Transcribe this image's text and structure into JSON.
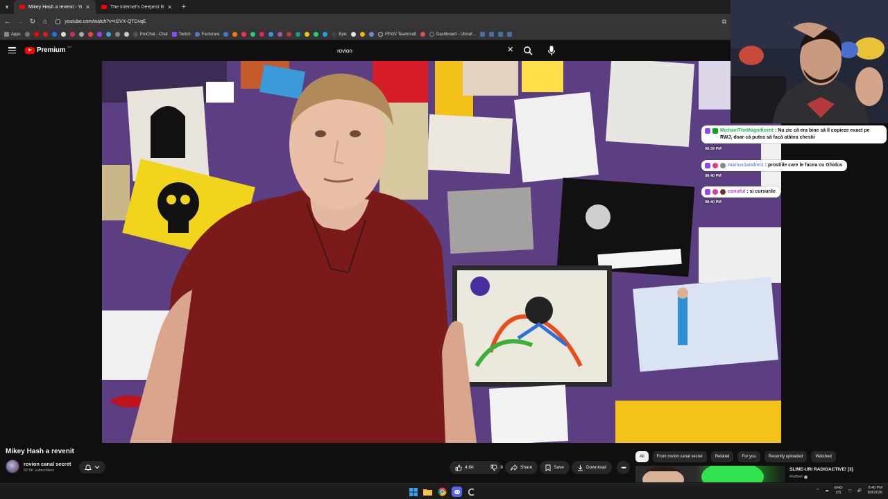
{
  "browser": {
    "tabs": [
      {
        "title": "Mikey Hash a revenit - YouTube",
        "active": true
      },
      {
        "title": "The Internet's Deepest Rabbit H",
        "active": false
      }
    ],
    "url": "youtube.com/watch?v=iI2VX-QTDvqE",
    "bookmarks": [
      {
        "label": "Apps",
        "color": "#888888"
      },
      {
        "label": "ProChat - Chat",
        "color": "#555555"
      },
      {
        "label": "Twitch",
        "color": "#9146ff"
      },
      {
        "label": "Facturare",
        "color": "#4a7bd0"
      },
      {
        "label": "Epic",
        "color": "#444444"
      },
      {
        "label": "FFXIV Teamcraft",
        "color": "#3a3a3a"
      },
      {
        "label": "Dashboard - Ubisof...",
        "color": "#333333"
      }
    ]
  },
  "youtube": {
    "logo_text": "Premium",
    "logo_sup": "RO",
    "search_query": "rovion"
  },
  "video": {
    "title": "Mikey Hash a revenit",
    "channel_name": "rovion canal secret",
    "subscribers": "92.5K subscribers",
    "likes": "4.6K",
    "dislikes": "8",
    "share_label": "Share",
    "save_label": "Save",
    "download_label": "Download"
  },
  "chips": [
    "All",
    "From rovion canal secret",
    "Related",
    "For you",
    "Recently uploaded",
    "Watched"
  ],
  "recommended": {
    "title": "SLIME-URI RADIOACTIVE! [3]",
    "channel": "iRaffael"
  },
  "chat": [
    {
      "user": "MichaelTheMagnificent",
      "sep": ":",
      "message": "Nu zic că era bine să îl copieze exact pe RWJ, doar că putea să facă atâtea chestii",
      "time": "08:39 PM"
    },
    {
      "user": "marius1andrei1",
      "sep": ":",
      "message": "prostiile care le facea cu Ghidus",
      "time": "08:40 PM"
    },
    {
      "user": "conuful",
      "sep": ":",
      "message": "si cursurile",
      "time": "08:40 PM"
    }
  ],
  "taskbar": {
    "lang_top": "ENG",
    "lang_bottom": "US",
    "time": "8:40 PM",
    "date": "8/9/2026"
  },
  "colors": {
    "youtube_red": "#ff0000",
    "twitch_purple": "#9146ff",
    "background": "#0f0f0f"
  }
}
